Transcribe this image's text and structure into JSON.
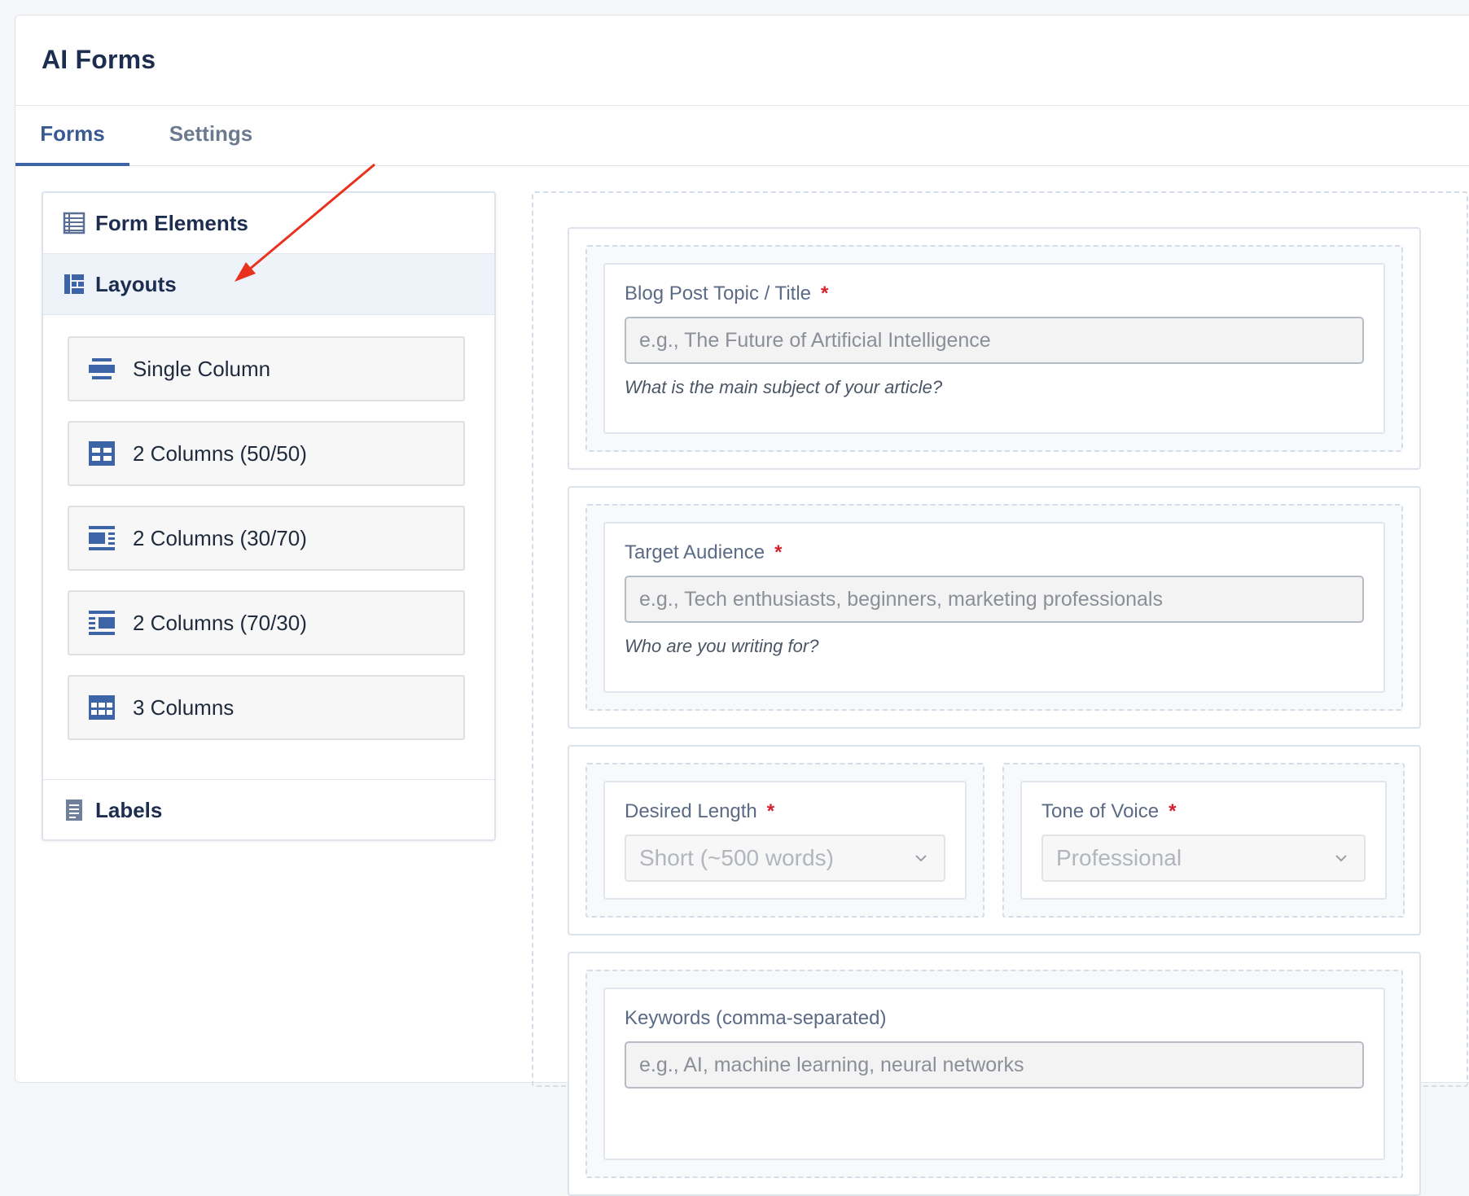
{
  "app": {
    "title": "AI Forms"
  },
  "tabs": [
    {
      "label": "Forms",
      "active": true
    },
    {
      "label": "Settings",
      "active": false
    }
  ],
  "sidebar": {
    "sections": {
      "form_elements": {
        "label": "Form Elements",
        "icon": "list-icon"
      },
      "layouts": {
        "label": "Layouts",
        "icon": "layout-icon",
        "expanded": true
      },
      "labels": {
        "label": "Labels",
        "icon": "document-icon"
      }
    },
    "layout_items": [
      {
        "label": "Single Column",
        "icon": "single-column-icon"
      },
      {
        "label": "2 Columns (50/50)",
        "icon": "two-columns-50-50-icon"
      },
      {
        "label": "2 Columns (30/70)",
        "icon": "two-columns-30-70-icon"
      },
      {
        "label": "2 Columns (70/30)",
        "icon": "two-columns-70-30-icon"
      },
      {
        "label": "3 Columns",
        "icon": "three-columns-icon"
      }
    ]
  },
  "form": {
    "fields": {
      "topic": {
        "label": "Blog Post Topic / Title",
        "required_mark": "*",
        "placeholder": "e.g., The Future of Artificial Intelligence",
        "help": "What is the main subject of your article?"
      },
      "audience": {
        "label": "Target Audience",
        "required_mark": "*",
        "placeholder": "e.g., Tech enthusiasts, beginners, marketing professionals",
        "help": "Who are you writing for?"
      },
      "length": {
        "label": "Desired Length",
        "required_mark": "*",
        "selected": "Short (~500 words)"
      },
      "tone": {
        "label": "Tone of Voice",
        "required_mark": "*",
        "selected": "Professional"
      },
      "keywords": {
        "label": "Keywords (comma-separated)",
        "placeholder": "e.g., AI, machine learning, neural networks"
      }
    }
  },
  "colors": {
    "accent": "#3c64a6",
    "required": "#d61f2c",
    "annotation_arrow": "#e8321e"
  }
}
